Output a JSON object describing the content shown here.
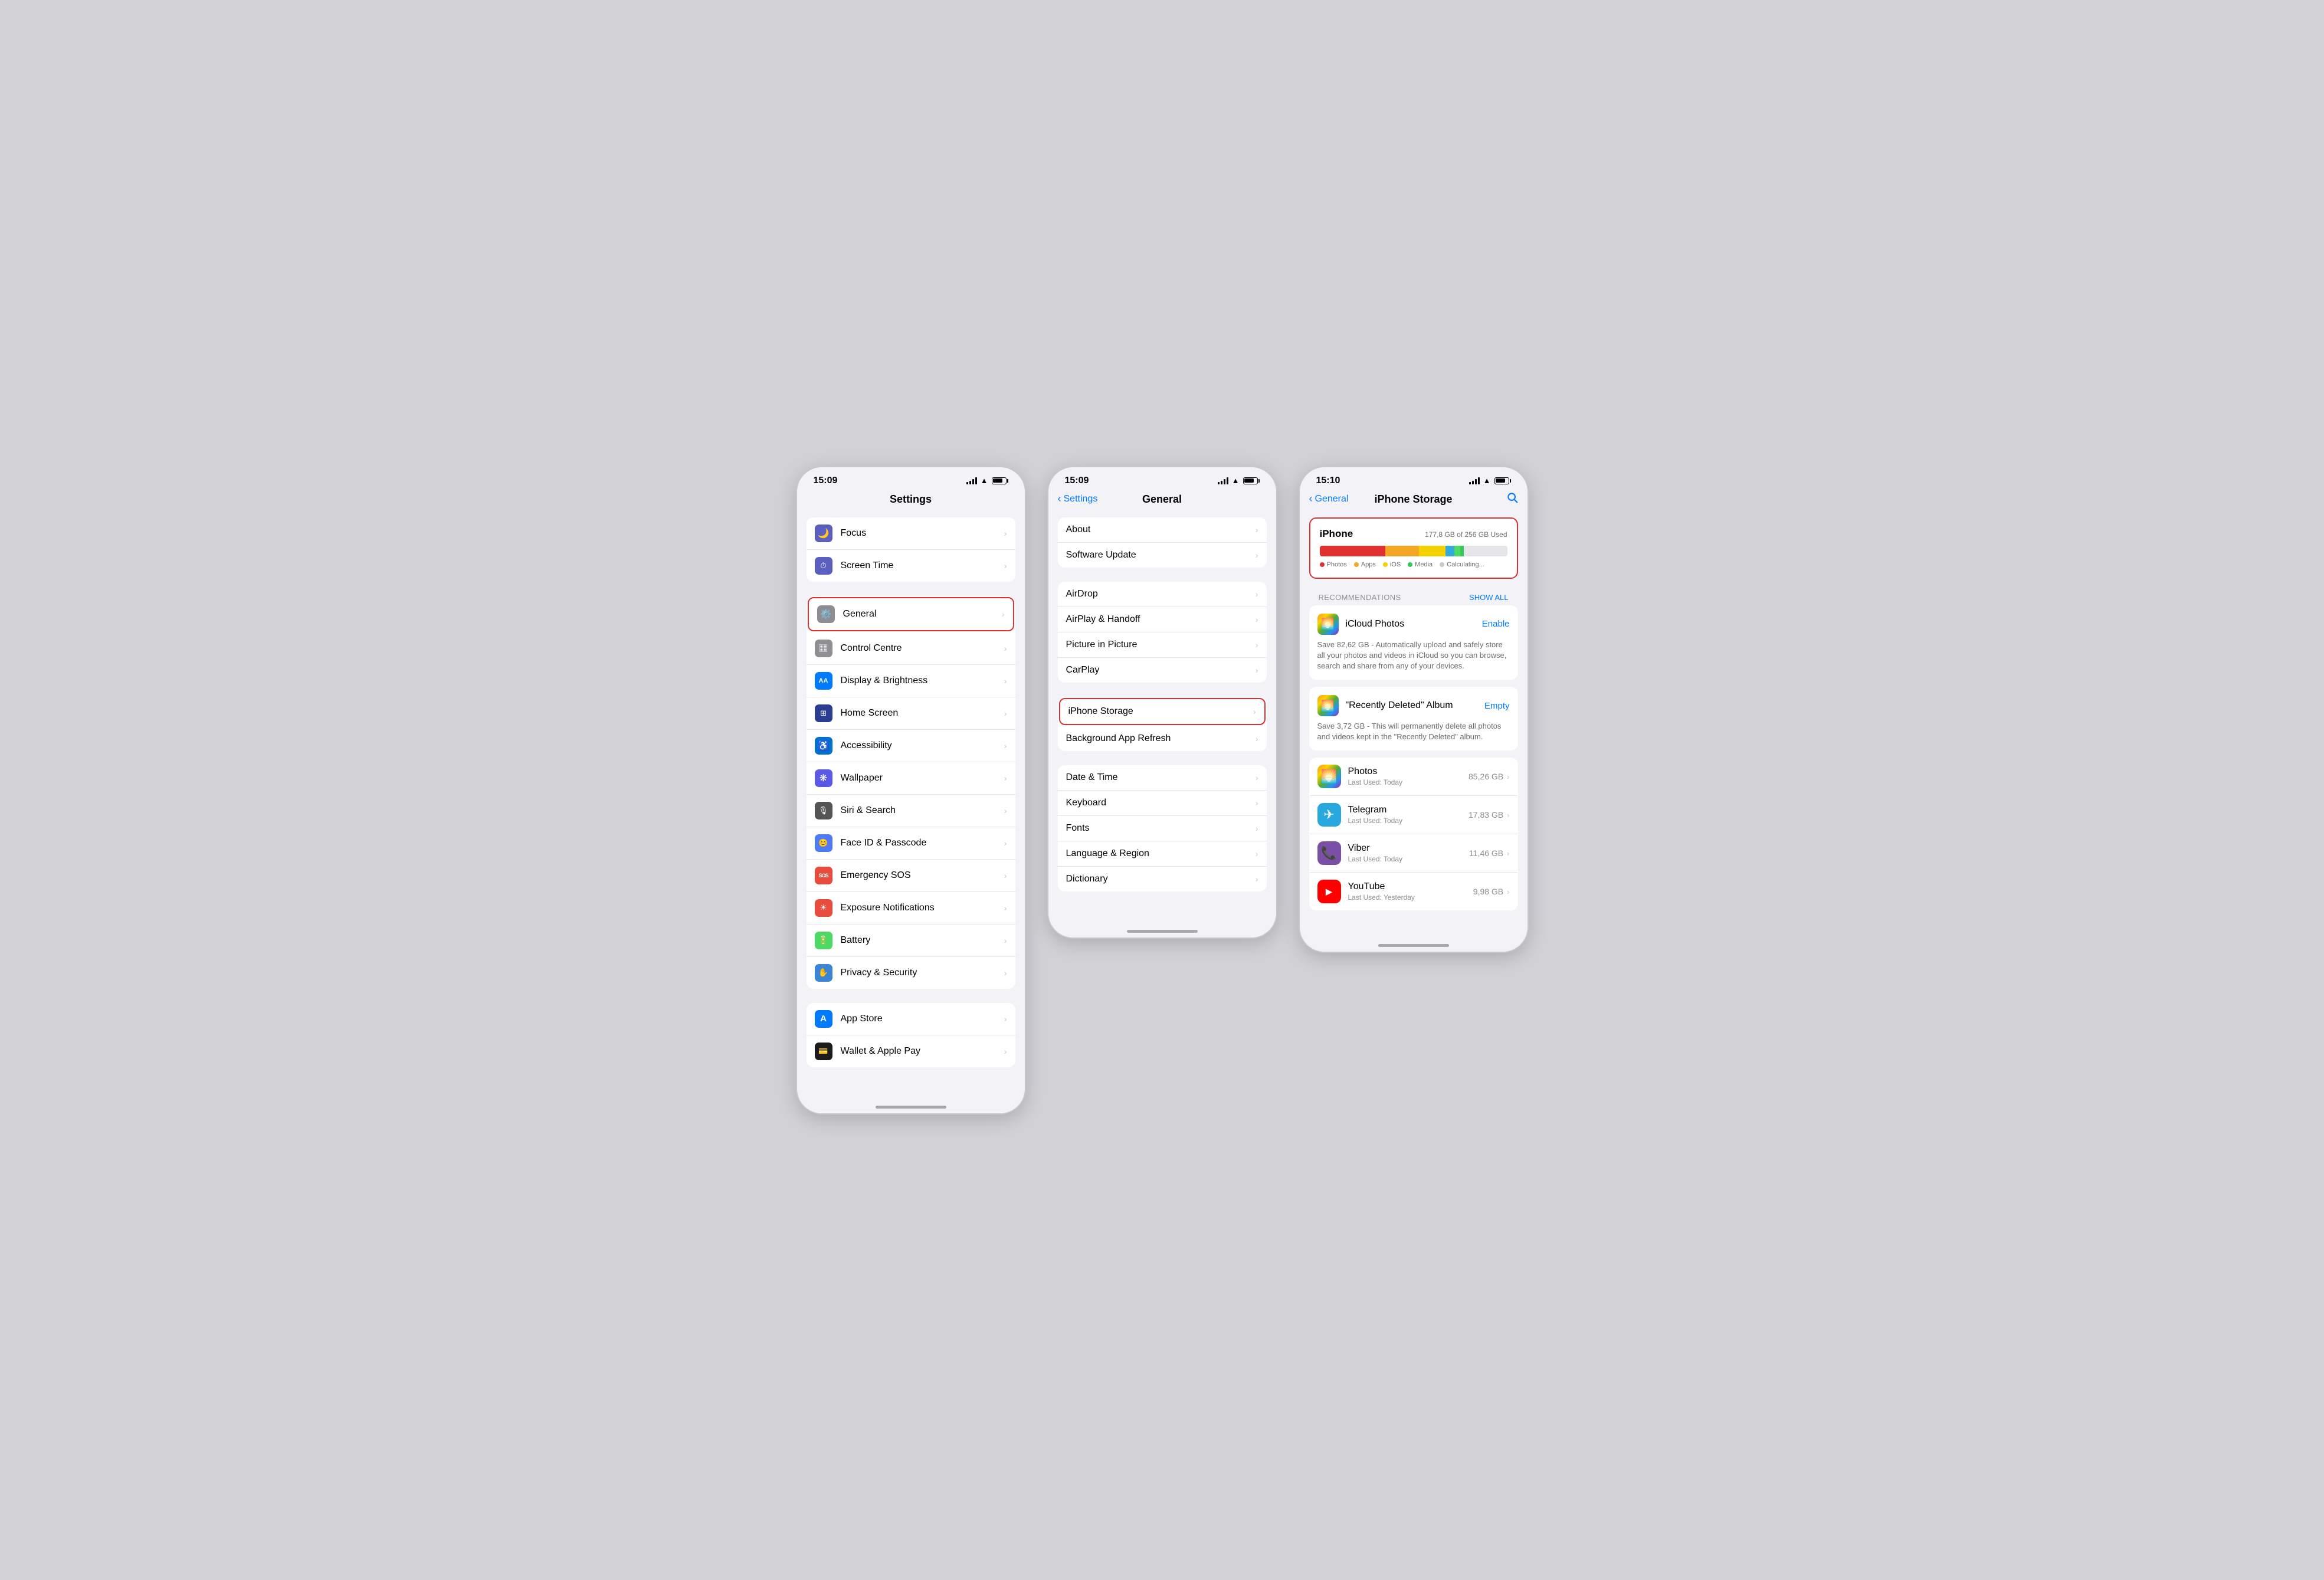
{
  "phone1": {
    "time": "15:09",
    "title": "Settings",
    "items_group1": [
      {
        "id": "focus",
        "label": "Focus",
        "icon_bg": "#5b5fbf",
        "icon": "🌙"
      },
      {
        "id": "screen-time",
        "label": "Screen Time",
        "icon_bg": "#5b5fbf",
        "icon": "⏱"
      }
    ],
    "items_group2": [
      {
        "id": "general",
        "label": "General",
        "icon_bg": "#8e8e93",
        "icon": "⚙️",
        "highlighted": true
      },
      {
        "id": "control-centre",
        "label": "Control Centre",
        "icon_bg": "#8e8e93",
        "icon": "🎛"
      },
      {
        "id": "display",
        "label": "Display & Brightness",
        "icon_bg": "#007aff",
        "icon": "AA"
      },
      {
        "id": "home-screen",
        "label": "Home Screen",
        "icon_bg": "#2c3e91",
        "icon": "⊞"
      },
      {
        "id": "accessibility",
        "label": "Accessibility",
        "icon_bg": "#0071d4",
        "icon": "♿"
      },
      {
        "id": "wallpaper",
        "label": "Wallpaper",
        "icon_bg": "#5a5ae6",
        "icon": "❋"
      },
      {
        "id": "siri-search",
        "label": "Siri & Search",
        "icon_bg": "#555",
        "icon": "🎙"
      },
      {
        "id": "face-id",
        "label": "Face ID & Passcode",
        "icon_bg": "#4f7af5",
        "icon": "😊"
      },
      {
        "id": "emergency-sos",
        "label": "Emergency SOS",
        "icon_bg": "#e74c3c",
        "icon": "SOS"
      },
      {
        "id": "exposure",
        "label": "Exposure Notifications",
        "icon_bg": "#e74c3c",
        "icon": "☀"
      },
      {
        "id": "battery",
        "label": "Battery",
        "icon_bg": "#4cd964",
        "icon": "🔋"
      },
      {
        "id": "privacy",
        "label": "Privacy & Security",
        "icon_bg": "#3a86d4",
        "icon": "✋"
      }
    ],
    "items_group3": [
      {
        "id": "app-store",
        "label": "App Store",
        "icon_bg": "#007aff",
        "icon": "A"
      },
      {
        "id": "wallet",
        "label": "Wallet & Apple Pay",
        "icon_bg": "#1c1c1e",
        "icon": "💳"
      }
    ]
  },
  "phone2": {
    "time": "15:09",
    "back_label": "Settings",
    "title": "General",
    "groups": [
      {
        "items": [
          {
            "id": "about",
            "label": "About"
          },
          {
            "id": "software-update",
            "label": "Software Update"
          }
        ]
      },
      {
        "items": [
          {
            "id": "airdrop",
            "label": "AirDrop"
          },
          {
            "id": "airplay-handoff",
            "label": "AirPlay & Handoff"
          },
          {
            "id": "picture-in-picture",
            "label": "Picture in Picture"
          },
          {
            "id": "carplay",
            "label": "CarPlay"
          }
        ]
      },
      {
        "items": [
          {
            "id": "iphone-storage",
            "label": "iPhone Storage",
            "highlighted": true
          },
          {
            "id": "background-app-refresh",
            "label": "Background App Refresh"
          }
        ]
      },
      {
        "items": [
          {
            "id": "date-time",
            "label": "Date & Time"
          },
          {
            "id": "keyboard",
            "label": "Keyboard"
          },
          {
            "id": "fonts",
            "label": "Fonts"
          },
          {
            "id": "language-region",
            "label": "Language & Region"
          },
          {
            "id": "dictionary",
            "label": "Dictionary"
          }
        ]
      }
    ]
  },
  "phone3": {
    "time": "15:10",
    "back_label": "General",
    "title": "iPhone Storage",
    "search_icon": "search",
    "storage": {
      "device": "iPhone",
      "used_text": "177,8 GB of 256 GB Used",
      "bar_segments": [
        {
          "color": "#e03030",
          "width": 35
        },
        {
          "color": "#f5a623",
          "width": 18
        },
        {
          "color": "#f5d100",
          "width": 14
        },
        {
          "color": "#34aadc",
          "width": 5
        },
        {
          "color": "#4cd964",
          "width": 6
        },
        {
          "color": "#e5e5ea",
          "width": 22
        }
      ],
      "legend": [
        {
          "color": "#e03030",
          "label": "Photos"
        },
        {
          "color": "#f5a623",
          "label": "Apps"
        },
        {
          "color": "#f5d100",
          "label": "iOS"
        },
        {
          "color": "#34aadc",
          "label": "Media"
        },
        {
          "color": "#8e8e93",
          "label": "Calculating..."
        }
      ]
    },
    "recommendations_label": "RECOMMENDATIONS",
    "show_all_label": "SHOW ALL",
    "recommendations": [
      {
        "id": "icloud-photos",
        "title": "iCloud Photos",
        "action": "Enable",
        "description": "Save 82,62 GB - Automatically upload and safely store all your photos and videos in iCloud so you can browse, search and share from any of your devices."
      },
      {
        "id": "recently-deleted",
        "title": "\"Recently Deleted\" Album",
        "action": "Empty",
        "description": "Save 3,72 GB - This will permanently delete all photos and videos kept in the \"Recently Deleted\" album."
      }
    ],
    "apps": [
      {
        "id": "photos",
        "name": "Photos",
        "last_used": "Last Used: Today",
        "size": "85,26 GB",
        "icon": "🌅",
        "icon_bg": "linear-gradient(135deg,#f7971e,#ffd200,#56ab2f,#2196f3,#9c27b0)"
      },
      {
        "id": "telegram",
        "name": "Telegram",
        "last_used": "Last Used: Today",
        "size": "17,83 GB",
        "icon": "✈",
        "icon_bg": "#29a8e0"
      },
      {
        "id": "viber",
        "name": "Viber",
        "last_used": "Last Used: Today",
        "size": "11,46 GB",
        "icon": "📞",
        "icon_bg": "#7b4fa6"
      },
      {
        "id": "youtube",
        "name": "YouTube",
        "last_used": "Last Used: Yesterday",
        "size": "9,98 GB",
        "icon": "▶",
        "icon_bg": "#ff0000"
      }
    ]
  }
}
